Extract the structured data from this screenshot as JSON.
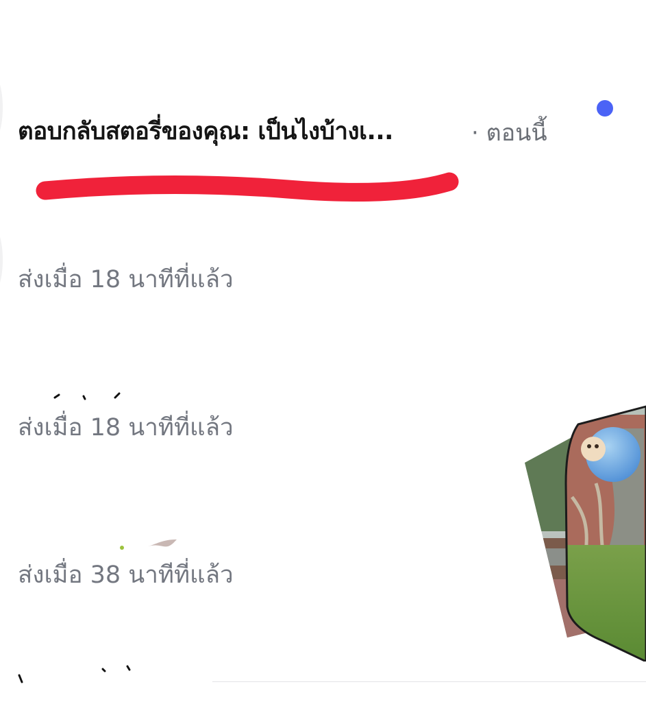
{
  "notification": {
    "title": "ตอบกลับสตอรี่ของคุณ: เป็นไงบ้างเ...",
    "time": "· ตอนนี้",
    "unread": true,
    "accent_color": "#4b63f6"
  },
  "sent_items": [
    {
      "meta": "ส่งเมื่อ 18 นาทีที่แล้ว"
    },
    {
      "meta": "ส่งเมื่อ 18 นาทีที่แล้ว"
    },
    {
      "meta": "ส่งเมื่อ 38 นาทีที่แล้ว"
    }
  ],
  "colors": {
    "redaction": "#f0223a",
    "meta_text": "#737780",
    "title_text": "#151515"
  },
  "story_preview": {
    "icon": "story-thumbnail-stack"
  }
}
